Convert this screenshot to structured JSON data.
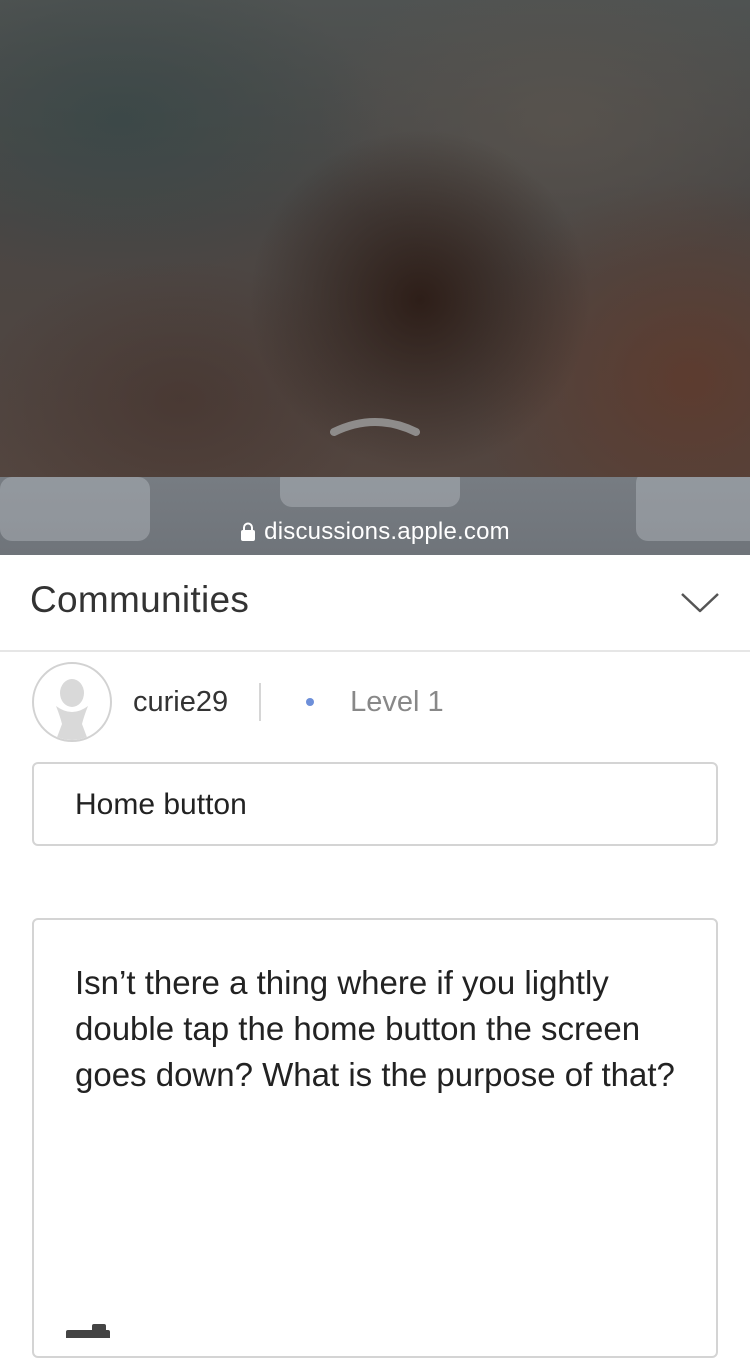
{
  "browser": {
    "url": "discussions.apple.com"
  },
  "header": {
    "title": "Communities"
  },
  "author": {
    "username": "curie29",
    "level": "Level 1"
  },
  "post": {
    "subject": "Home button",
    "body": "Isn’t there a thing where if you lightly double tap the home button the screen goes down? What is the purpose of that?"
  },
  "icons": {
    "lock": "lock-icon",
    "chevron_down": "chevron-down-icon",
    "avatar": "avatar-placeholder-icon",
    "reachability": "chevron-up-icon",
    "camera": "camera-icon"
  },
  "colors": {
    "level_dot": "#6d8fd9",
    "border": "#d4d4d4"
  }
}
